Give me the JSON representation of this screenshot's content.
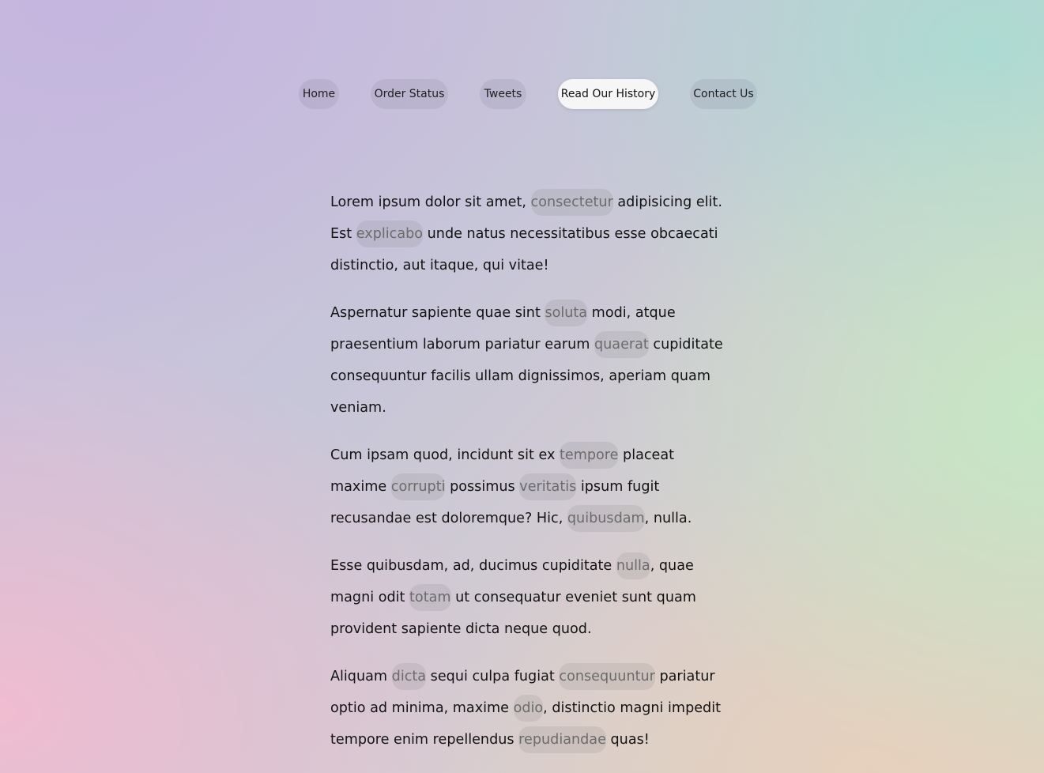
{
  "nav": {
    "items": [
      {
        "label": "Home",
        "active": false
      },
      {
        "label": "Order Status",
        "active": false
      },
      {
        "label": "Tweets",
        "active": false
      },
      {
        "label": "Read Our History",
        "active": true
      },
      {
        "label": "Contact Us",
        "active": false
      }
    ]
  },
  "content": {
    "paragraphs": [
      {
        "segments": [
          {
            "text": "Lorem ipsum dolor sit amet, ",
            "highlight": false
          },
          {
            "text": "consectetur",
            "highlight": true
          },
          {
            "text": " adipisicing elit. Est ",
            "highlight": false
          },
          {
            "text": "explicabo",
            "highlight": true
          },
          {
            "text": " unde natus necessitatibus esse obcaecati distinctio, aut itaque, qui vitae!",
            "highlight": false
          }
        ]
      },
      {
        "segments": [
          {
            "text": "Aspernatur sapiente quae sint ",
            "highlight": false
          },
          {
            "text": "soluta",
            "highlight": true
          },
          {
            "text": " modi, atque praesentium laborum pariatur earum ",
            "highlight": false
          },
          {
            "text": "quaerat",
            "highlight": true
          },
          {
            "text": " cupiditate consequuntur facilis ullam dignissimos, aperiam quam veniam.",
            "highlight": false
          }
        ]
      },
      {
        "segments": [
          {
            "text": "Cum ipsam quod, incidunt sit ex ",
            "highlight": false
          },
          {
            "text": "tempore",
            "highlight": true
          },
          {
            "text": " placeat maxime ",
            "highlight": false
          },
          {
            "text": "corrupti",
            "highlight": true
          },
          {
            "text": " possimus ",
            "highlight": false
          },
          {
            "text": "veritatis",
            "highlight": true
          },
          {
            "text": " ipsum fugit recusandae est doloremque? Hic, ",
            "highlight": false
          },
          {
            "text": "quibusdam",
            "highlight": true
          },
          {
            "text": ", nulla.",
            "highlight": false
          }
        ]
      },
      {
        "segments": [
          {
            "text": "Esse quibusdam, ad, ducimus cupiditate ",
            "highlight": false
          },
          {
            "text": "nulla",
            "highlight": true
          },
          {
            "text": ", quae magni odit ",
            "highlight": false
          },
          {
            "text": "totam",
            "highlight": true
          },
          {
            "text": " ut consequatur eveniet sunt quam provident sapiente dicta neque quod.",
            "highlight": false
          }
        ]
      },
      {
        "segments": [
          {
            "text": "Aliquam ",
            "highlight": false
          },
          {
            "text": "dicta",
            "highlight": true
          },
          {
            "text": " sequi culpa fugiat ",
            "highlight": false
          },
          {
            "text": "consequuntur",
            "highlight": true
          },
          {
            "text": " pariatur optio ad minima, maxime ",
            "highlight": false
          },
          {
            "text": "odio",
            "highlight": true
          },
          {
            "text": ", distinctio magni impedit tempore enim repellendus ",
            "highlight": false
          },
          {
            "text": "repudiandae",
            "highlight": true
          },
          {
            "text": " quas!",
            "highlight": false
          }
        ]
      }
    ]
  }
}
